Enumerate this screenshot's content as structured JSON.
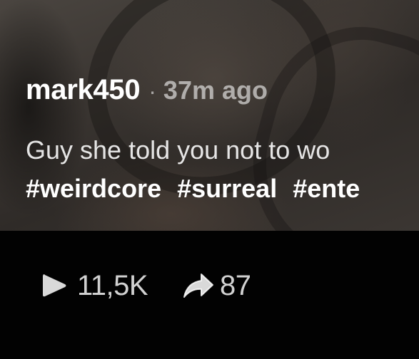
{
  "post": {
    "username": "mark450",
    "separator": "·",
    "time_ago": "37m ago",
    "caption": "Guy she told you not to wo",
    "hashtags": [
      "#weirdcore",
      "#surreal",
      "#ente"
    ]
  },
  "actions": {
    "views": {
      "icon": "play-icon",
      "count": "11,5K"
    },
    "shares": {
      "icon": "share-arrow-icon",
      "count": "87"
    }
  }
}
